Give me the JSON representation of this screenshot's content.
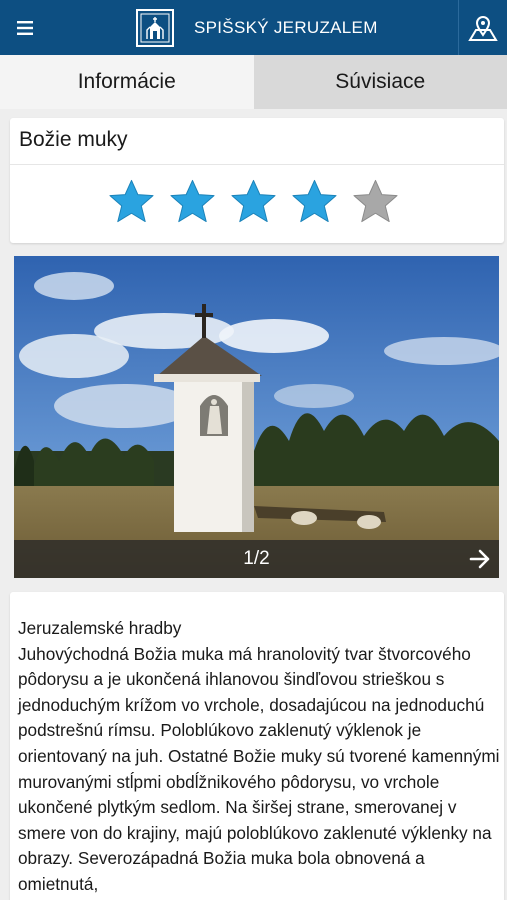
{
  "header": {
    "title": "SPIŠSKÝ JERUZALEM",
    "menu_icon": "hamburger-menu-icon",
    "logo_icon": "church-logo-icon",
    "map_icon": "map-pin-icon",
    "color": "#0d4f82"
  },
  "tabs": [
    {
      "label": "Informácie",
      "active": true
    },
    {
      "label": "Súvisiace",
      "active": false
    }
  ],
  "place": {
    "name": "Božie muky",
    "rating": 4,
    "rating_max": 5,
    "star_color": "#2aa3e0",
    "star_empty_color": "#a8a8a8"
  },
  "gallery": {
    "counter": "1/2",
    "next_icon": "arrow-right-icon"
  },
  "description": {
    "heading": "Jeruzalemské hradby",
    "body": "Juhovýchodná Božia muka má hranolovitý tvar štvorcového pôdorysu a je ukončená ihlanovou šindľovou strieškou s jednoduchým krížom vo vrchole, dosadajúcou na jednoduchú podstrešnú rímsu. Poloblúkovo zaklenutý výklenok je orientovaný na juh. Ostatné Božie muky sú tvorené kamennými murovanými stĺpmi obdĺžnikového pôdorysu, vo vrchole ukončené plytkým sedlom. Na širšej strane, smerovanej v smere von do krajiny, majú poloblúkovo zaklenuté výklenky na obrazy. Severozápadná Božia muka bola obnovená a omietnutá,"
  }
}
